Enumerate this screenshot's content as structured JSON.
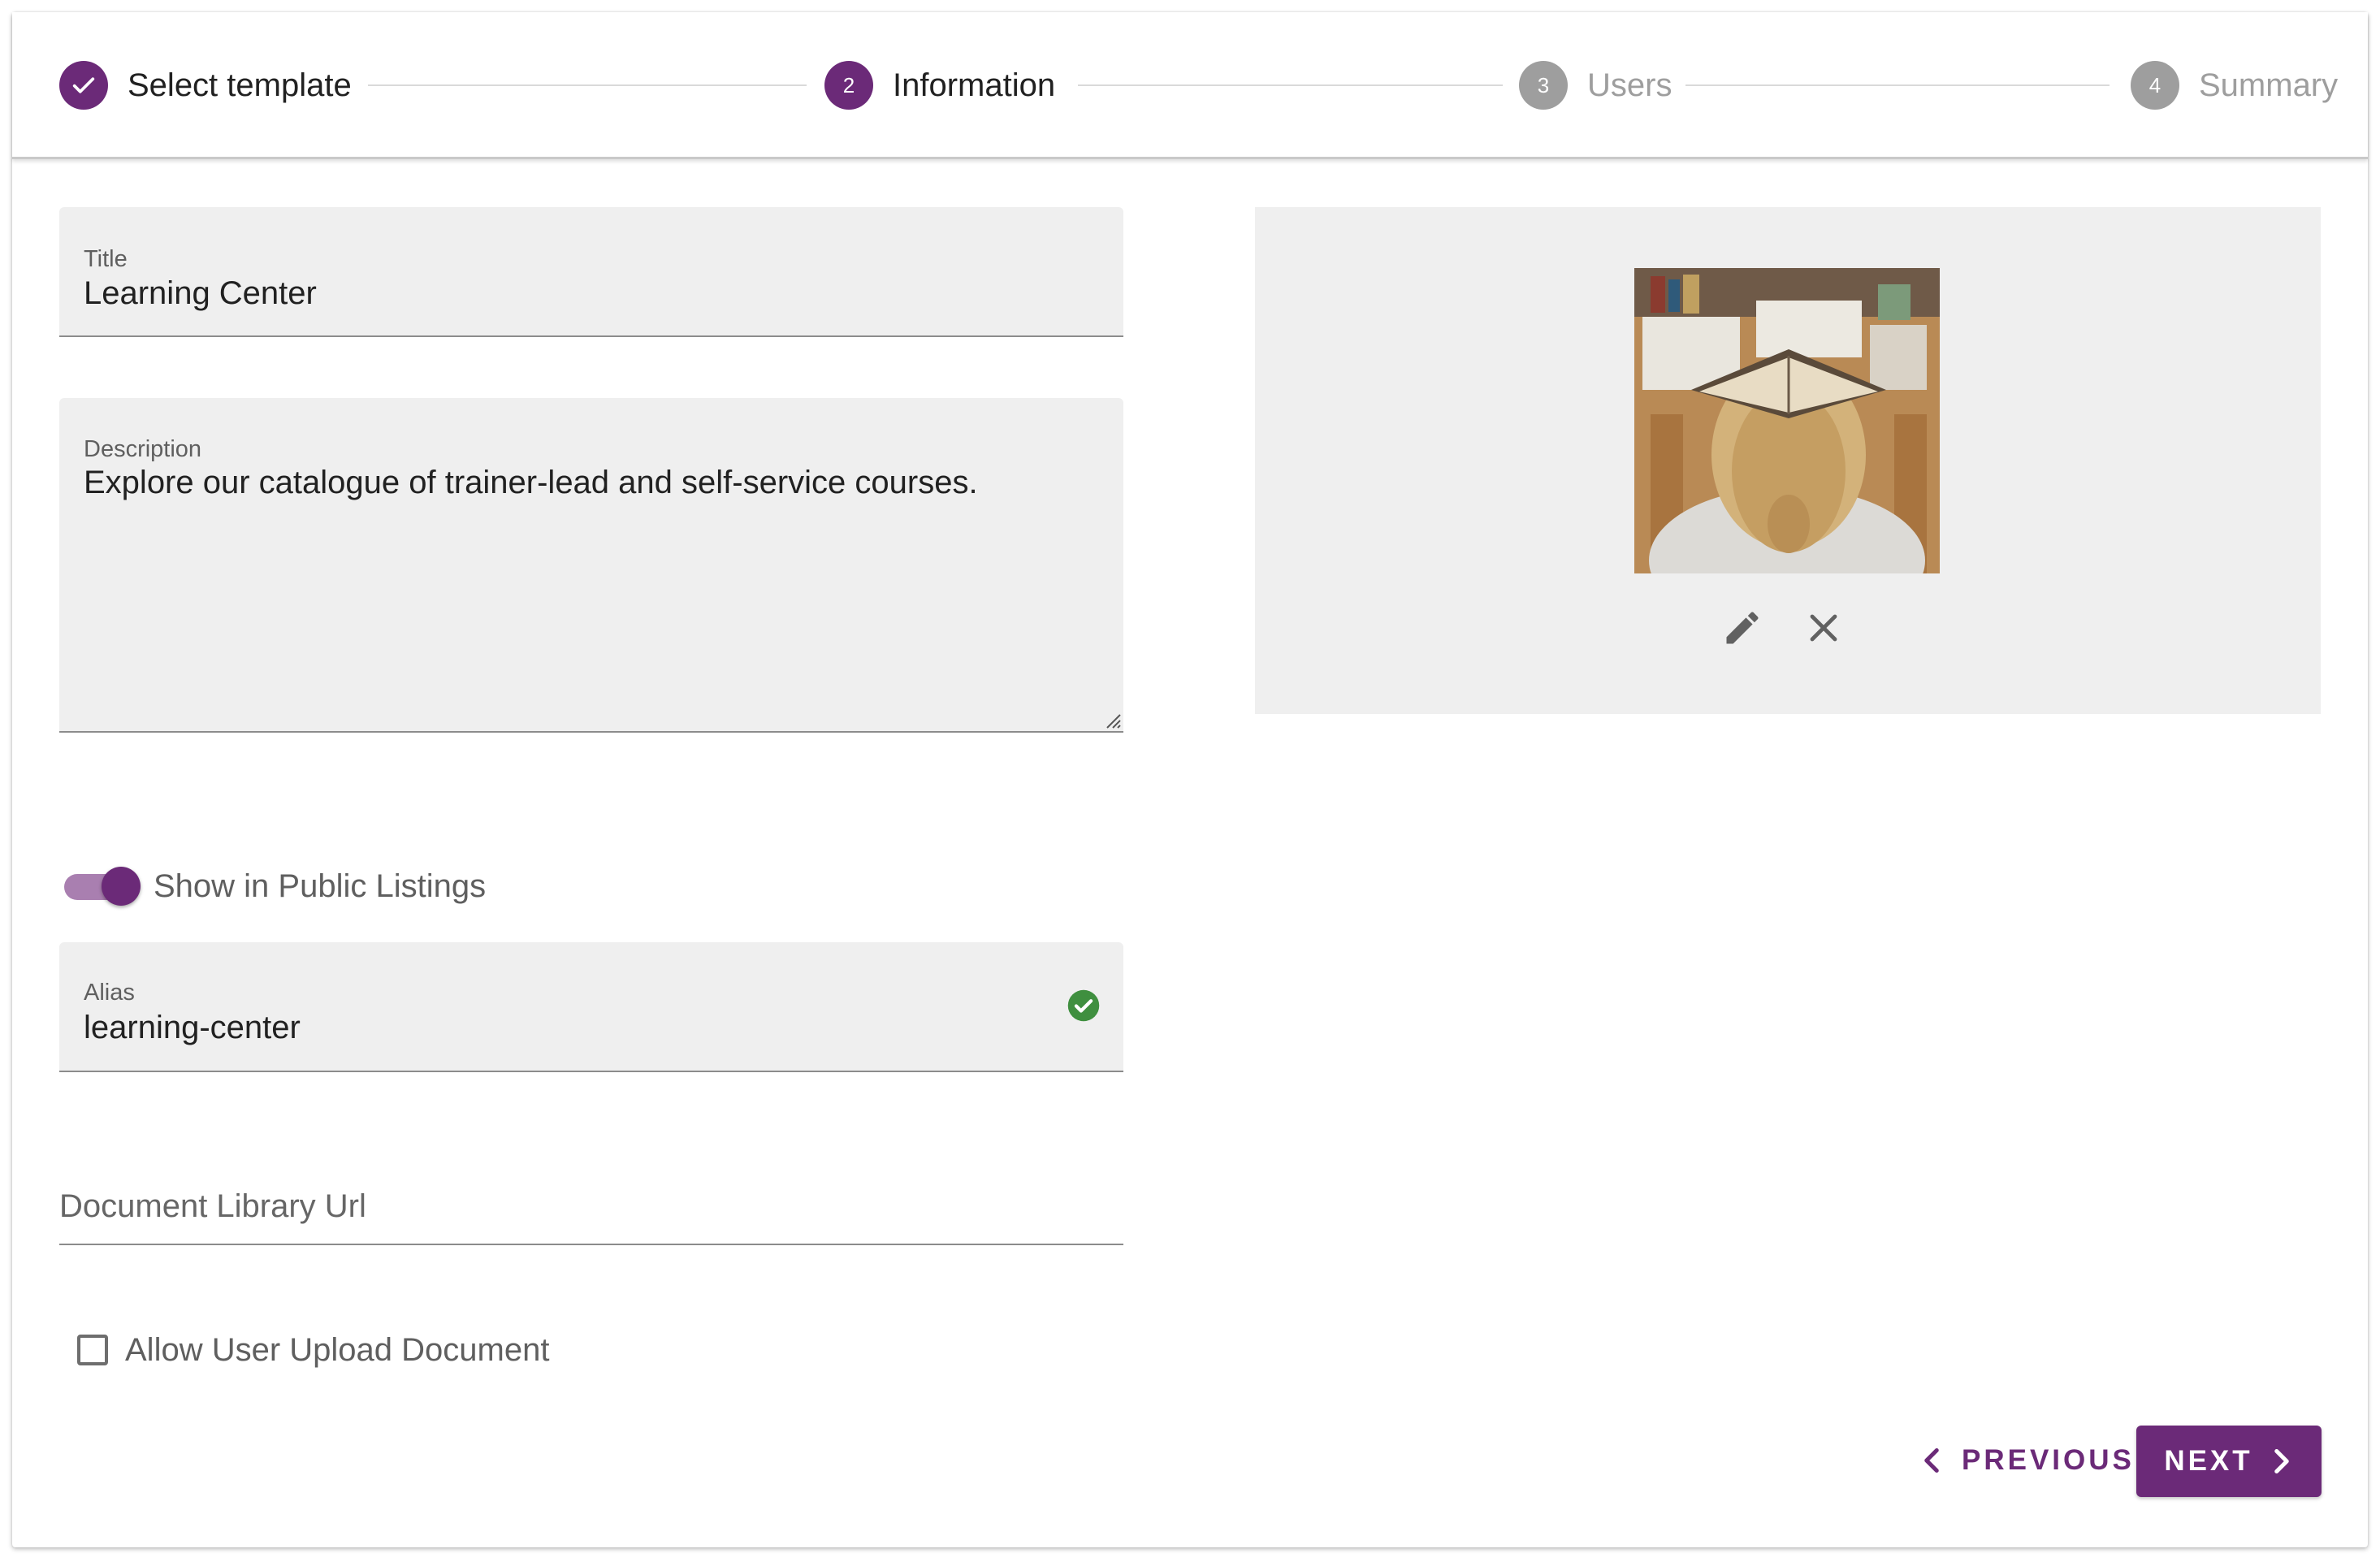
{
  "stepper": {
    "steps": [
      {
        "label": "Select template",
        "state": "completed",
        "icon": "check-icon"
      },
      {
        "label": "Information",
        "number": "2",
        "state": "active"
      },
      {
        "label": "Users",
        "number": "3",
        "state": "inactive"
      },
      {
        "label": "Summary",
        "number": "4",
        "state": "inactive"
      }
    ]
  },
  "form": {
    "title": {
      "label": "Title",
      "value": "Learning Center"
    },
    "description": {
      "label": "Description",
      "value": "Explore our catalogue of trainer-lead and self-service courses."
    },
    "public_listing": {
      "label": "Show in Public Listings",
      "checked": true
    },
    "alias": {
      "label": "Alias",
      "value": "learning-center",
      "status_icon": "check-circle-icon"
    },
    "document_library_url": {
      "placeholder": "Document Library Url",
      "value": ""
    },
    "allow_upload": {
      "label": "Allow User Upload Document",
      "checked": false
    }
  },
  "image_panel": {
    "edit_icon": "pencil-icon",
    "remove_icon": "close-icon"
  },
  "actions": {
    "previous_label": "PREVIOUS",
    "next_label": "NEXT"
  },
  "colors": {
    "primary": "#6b2a78",
    "inactive_step": "#9e9e9e",
    "field_bg": "#efefef",
    "success": "#3f8f3f"
  }
}
